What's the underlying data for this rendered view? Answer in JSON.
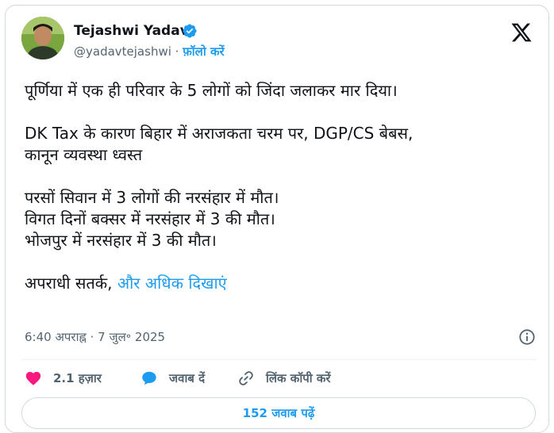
{
  "author": {
    "name": "Tejashwi Yadav",
    "handle": "@yadavtejashwi",
    "separator": "·",
    "follow_label": "फ़ॉलो करें"
  },
  "tweet": {
    "paragraphs": [
      [
        "पूर्णिया में एक ही परिवार के 5 लोगों को जिंदा जलाकर मार दिया।"
      ],
      [
        "DK Tax के कारण बिहार में अराजकता चरम पर, DGP/CS बेबस,",
        "कानून व्यवस्था ध्वस्त"
      ],
      [
        "परसों सिवान में 3 लोगों की नरसंहार में मौत।",
        "विगत दिनों बक्सर में नरसंहार में 3 की मौत।",
        "भोजपुर में नरसंहार में 3 की मौत।"
      ]
    ],
    "last_line_text": "अपराधी सतर्क,",
    "show_more": "और अधिक दिखाएं",
    "time": "6:40 अपराह्न",
    "date_separator": "·",
    "date": "7 जुल॰ 2025"
  },
  "actions": {
    "likes": "2.1 हज़ार",
    "reply": "जवाब दें",
    "copy_link": "लिंक कॉपी करें"
  },
  "replies_button": "152 जवाब पढ़ें",
  "colors": {
    "accent": "#1d9bf0",
    "like": "#f91880",
    "text": "#0f1419",
    "muted": "#536471",
    "border": "#cfd9de"
  },
  "icons": {
    "verified": "verified-badge-icon",
    "x_logo": "x-logo-icon",
    "info": "info-icon",
    "heart": "heart-icon",
    "reply": "reply-bubble-icon",
    "link": "link-icon"
  }
}
